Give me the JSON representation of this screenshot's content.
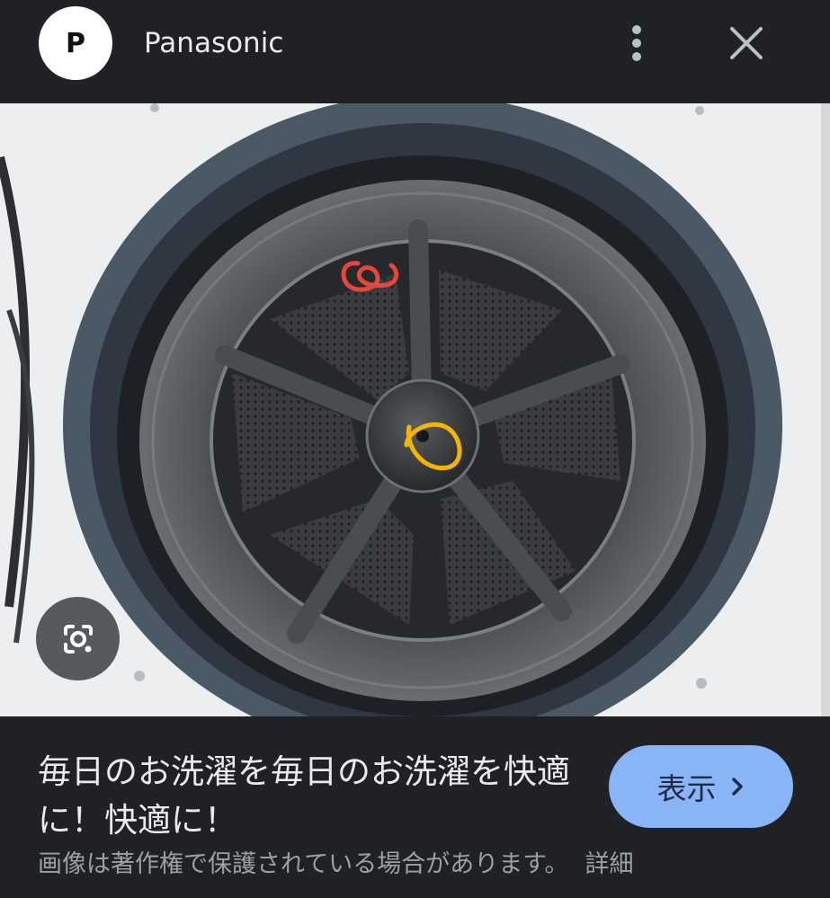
{
  "header": {
    "avatar_letter": "P",
    "site_name": "Panasonic",
    "more_icon": "more-vert-icon",
    "close_icon": "close-icon"
  },
  "image": {
    "subject": "washer-dryer drum interior",
    "annotations": [
      {
        "color": "#e8453c",
        "shape": "scribble"
      },
      {
        "color": "#f5b400",
        "shape": "circle"
      }
    ]
  },
  "lens": {
    "icon": "google-lens-icon"
  },
  "footer": {
    "title": "毎日のお洗濯を毎日のお洗濯を快適に！快適に！",
    "view_button_label": "表示",
    "copyright_text": "画像は著作権で保護されている場合があります。",
    "details_link": "詳細"
  },
  "colors": {
    "background": "#202124",
    "button": "#8ab4f8",
    "text_primary": "#e8eaed",
    "text_secondary": "#9aa0a6"
  }
}
